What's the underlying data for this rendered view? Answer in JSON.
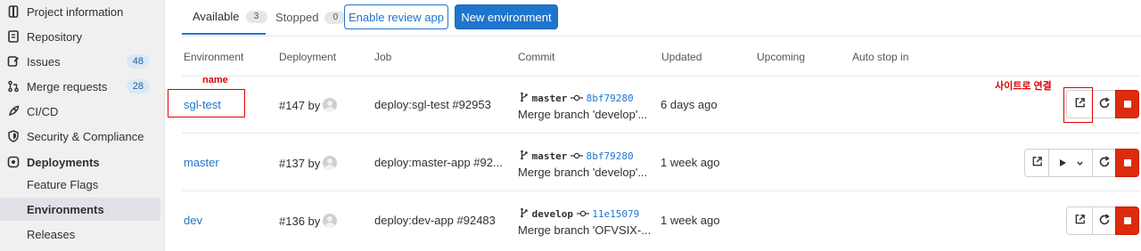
{
  "sidebar": {
    "items": [
      {
        "label": "Project information",
        "icon": "document-icon"
      },
      {
        "label": "Repository",
        "icon": "repository-icon"
      },
      {
        "label": "Issues",
        "icon": "issues-icon",
        "badge": "48"
      },
      {
        "label": "Merge requests",
        "icon": "merge-request-icon",
        "badge": "28"
      },
      {
        "label": "CI/CD",
        "icon": "rocket-icon"
      },
      {
        "label": "Security & Compliance",
        "icon": "shield-icon"
      },
      {
        "label": "Deployments",
        "icon": "deployments-icon"
      },
      {
        "label": "Feature Flags"
      },
      {
        "label": "Environments"
      },
      {
        "label": "Releases"
      }
    ]
  },
  "tabs": {
    "available": {
      "label": "Available",
      "count": "3"
    },
    "stopped": {
      "label": "Stopped",
      "count": "0"
    }
  },
  "buttons": {
    "enable_review": "Enable review app",
    "new_environment": "New environment"
  },
  "table": {
    "headers": [
      "Environment",
      "Deployment",
      "Job",
      "Commit",
      "Updated",
      "Upcoming",
      "Auto stop in"
    ],
    "rows": [
      {
        "environment": "sgl-test",
        "deployment": "#147 by",
        "job": "deploy:sgl-test #92953",
        "ref": "master",
        "sha": "8bf79280",
        "message": "Merge branch 'develop'...",
        "updated": "6 days ago"
      },
      {
        "environment": "master",
        "deployment": "#137 by",
        "job": "deploy:master-app #92...",
        "ref": "master",
        "sha": "8bf79280",
        "message": "Merge branch 'develop'...",
        "updated": "1 week ago"
      },
      {
        "environment": "dev",
        "deployment": "#136 by",
        "job": "deploy:dev-app #92483",
        "ref": "develop",
        "sha": "11e15079",
        "message": "Merge branch 'OFVSIX-...",
        "updated": "1 week ago"
      }
    ]
  },
  "annotations": {
    "name_label": "name",
    "site_link_label": "사이트로 연결"
  },
  "colors": {
    "primary": "#1f75cb",
    "danger": "#dd2b0e",
    "annotation": "#e00000"
  }
}
